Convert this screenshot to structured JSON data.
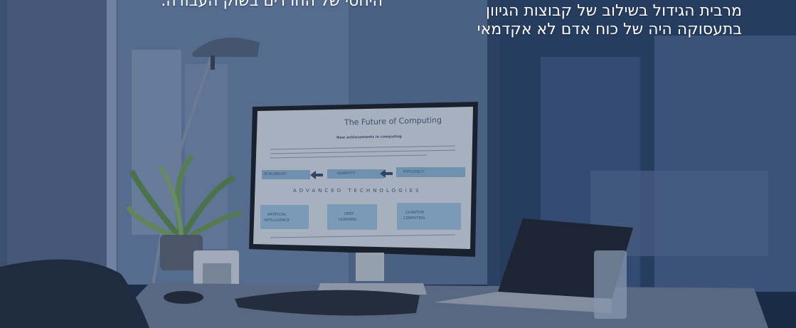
{
  "captions": {
    "right_line1": "מרבית הגידול בשילוב של קבוצות הגיוון",
    "right_line2": "בתעסוקה היה של כוח אדם לא אקדמאי",
    "left_line1": "",
    "left_line2": "היחסי של החרדים בשוק העבודה."
  },
  "monitor_screen": {
    "title": "The Future of Computing",
    "subtitle": "New achievements in computing",
    "flow_labels": [
      "SCALABILITY",
      "QUANTITY",
      "EFFICIENCY"
    ],
    "section_heading": "ADVANCED TECHNOLOGIES",
    "tech_boxes": [
      [
        "QUANTUM",
        "COMPUTING"
      ],
      [
        "DEEP",
        "LEARNING"
      ],
      [
        "ARTIFICIAL",
        "INTELLIGENCE"
      ]
    ]
  },
  "colors": {
    "overlay": "#1f3358",
    "text": "#ffffff"
  }
}
